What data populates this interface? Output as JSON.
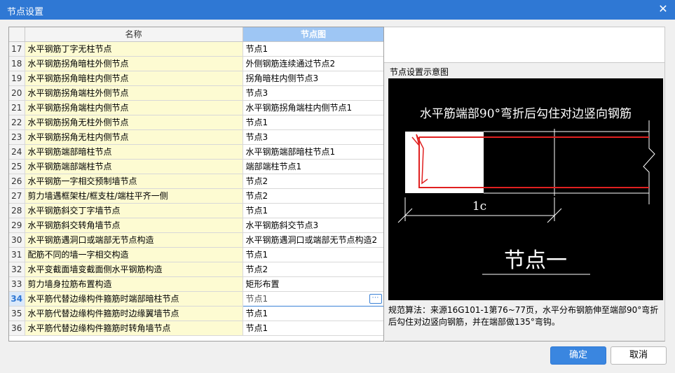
{
  "window": {
    "title": "节点设置"
  },
  "grid": {
    "headers": {
      "name": "名称",
      "image": "节点图"
    },
    "rows": [
      {
        "num": "17",
        "name": "水平钢筋丁字无柱节点",
        "value": "节点1"
      },
      {
        "num": "18",
        "name": "水平钢筋拐角暗柱外侧节点",
        "value": "外侧钢筋连续通过节点2"
      },
      {
        "num": "19",
        "name": "水平钢筋拐角暗柱内侧节点",
        "value": "拐角暗柱内侧节点3"
      },
      {
        "num": "20",
        "name": "水平钢筋拐角端柱外侧节点",
        "value": "节点3"
      },
      {
        "num": "21",
        "name": "水平钢筋拐角端柱内侧节点",
        "value": "水平钢筋拐角端柱内侧节点1"
      },
      {
        "num": "22",
        "name": "水平钢筋拐角无柱外侧节点",
        "value": "节点1"
      },
      {
        "num": "23",
        "name": "水平钢筋拐角无柱内侧节点",
        "value": "节点3"
      },
      {
        "num": "24",
        "name": "水平钢筋端部暗柱节点",
        "value": "水平钢筋端部暗柱节点1"
      },
      {
        "num": "25",
        "name": "水平钢筋端部端柱节点",
        "value": "端部端柱节点1"
      },
      {
        "num": "26",
        "name": "水平钢筋一字相交预制墙节点",
        "value": "节点2"
      },
      {
        "num": "27",
        "name": "剪力墙遇框架柱/框支柱/端柱平齐一侧",
        "value": "节点2"
      },
      {
        "num": "28",
        "name": "水平钢筋斜交丁字墙节点",
        "value": "节点1"
      },
      {
        "num": "29",
        "name": "水平钢筋斜交转角墙节点",
        "value": "水平钢筋斜交节点3"
      },
      {
        "num": "30",
        "name": "水平钢筋遇洞口或端部无节点构造",
        "value": "水平钢筋遇洞口或端部无节点构造2"
      },
      {
        "num": "31",
        "name": "配筋不同的墙一字相交构造",
        "value": "节点1"
      },
      {
        "num": "32",
        "name": "水平变截面墙变截面侧水平钢筋构造",
        "value": "节点2"
      },
      {
        "num": "33",
        "name": "剪力墙身拉筋布置构造",
        "value": "矩形布置"
      },
      {
        "num": "34",
        "name": "水平筋代替边缘构件箍筋时端部暗柱节点",
        "value": "节点1",
        "selected": true
      },
      {
        "num": "35",
        "name": "水平筋代替边缘构件箍筋时边缘翼墙节点",
        "value": "节点1"
      },
      {
        "num": "36",
        "name": "水平筋代替边缘构件箍筋时转角墙节点",
        "value": "节点1"
      }
    ]
  },
  "preview": {
    "title": "节点设置示意图",
    "diagram_caption": "水平筋端部90°弯折后勾住对边竖向钢筋",
    "dimension_label": "1c",
    "node_label": "节点一",
    "description": "规范算法：来源16G101-1第76~77页，水平分布钢筋伸至端部90°弯折后勾住对边竖向钢筋，并在端部做135°弯钩。",
    "colors": {
      "background": "#000000",
      "rebar": "#e02020",
      "lines": "#ffffff"
    }
  },
  "buttons": {
    "ok": "确定",
    "cancel": "取消"
  },
  "icons": {
    "close": "close-icon",
    "ellipsis": "ellipsis-icon"
  }
}
